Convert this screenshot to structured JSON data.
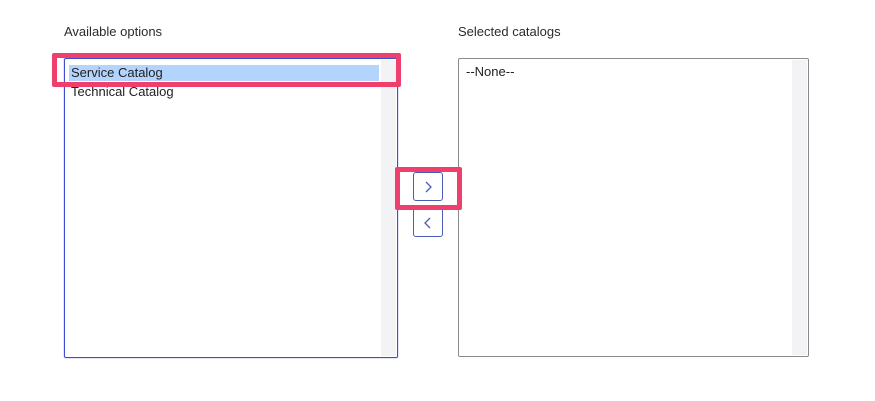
{
  "available": {
    "label": "Available options",
    "options": [
      {
        "label": "Service Catalog",
        "selected": true
      },
      {
        "label": "Technical Catalog",
        "selected": false
      }
    ]
  },
  "selected": {
    "label": "Selected catalogs",
    "options": [
      {
        "label": "--None--"
      }
    ]
  },
  "controls": {
    "add_icon": "chevron-right-icon",
    "remove_icon": "chevron-left-icon"
  },
  "colors": {
    "highlight": "#ef3f6c",
    "focus_border": "#3a4fd6",
    "selected_option_bg": "#b3d4fc",
    "button_border": "#4b5bb8"
  }
}
